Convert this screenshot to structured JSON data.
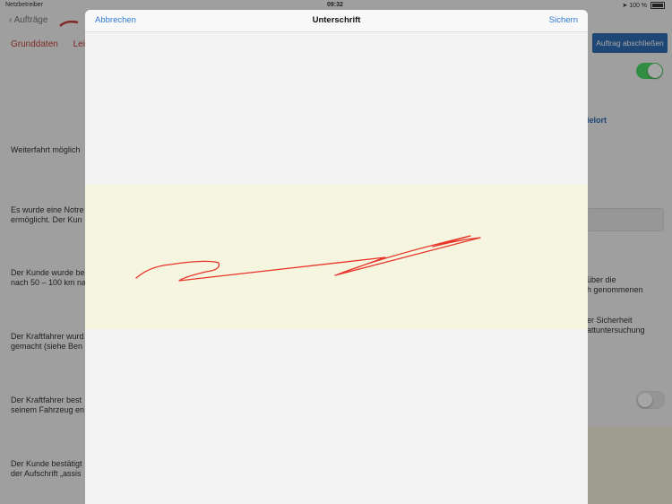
{
  "status_bar": {
    "carrier": "Netzbetreiber",
    "time": "09:32",
    "battery": "100 %"
  },
  "nav": {
    "back_label": "Aufträge"
  },
  "tabs": [
    "Grunddaten",
    "Leis"
  ],
  "finish_button": "Auftrag abschließen",
  "background_text": [
    [
      "Weiterfahrt möglich"
    ],
    [
      "Es wurde eine Notre",
      "ermöglicht. Der Kun"
    ],
    [
      "Der Kunde wurde be",
      "nach 50 – 100 km na"
    ],
    [
      "Der Kraftfahrer wurd",
      "gemacht (siehe Ben"
    ],
    [
      "Der Kraftfahrer best",
      "seinem Fahrzeug en"
    ],
    [
      "Der Kunde bestätigt",
      "der Aufschrift „assis"
    ]
  ],
  "background_right": {
    "link": "ielort",
    "text1": [
      "über die",
      "h genommenen"
    ],
    "text2": [
      "er Sicherheit",
      "attuntersuchung"
    ]
  },
  "modal": {
    "cancel": "Abbrechen",
    "title": "Unterschrift",
    "save": "Sichern"
  },
  "colors": {
    "accent": "#2f7ad0",
    "signature": "#e8342a",
    "pad": "#f6f5df",
    "brand_red": "#c4403a"
  }
}
